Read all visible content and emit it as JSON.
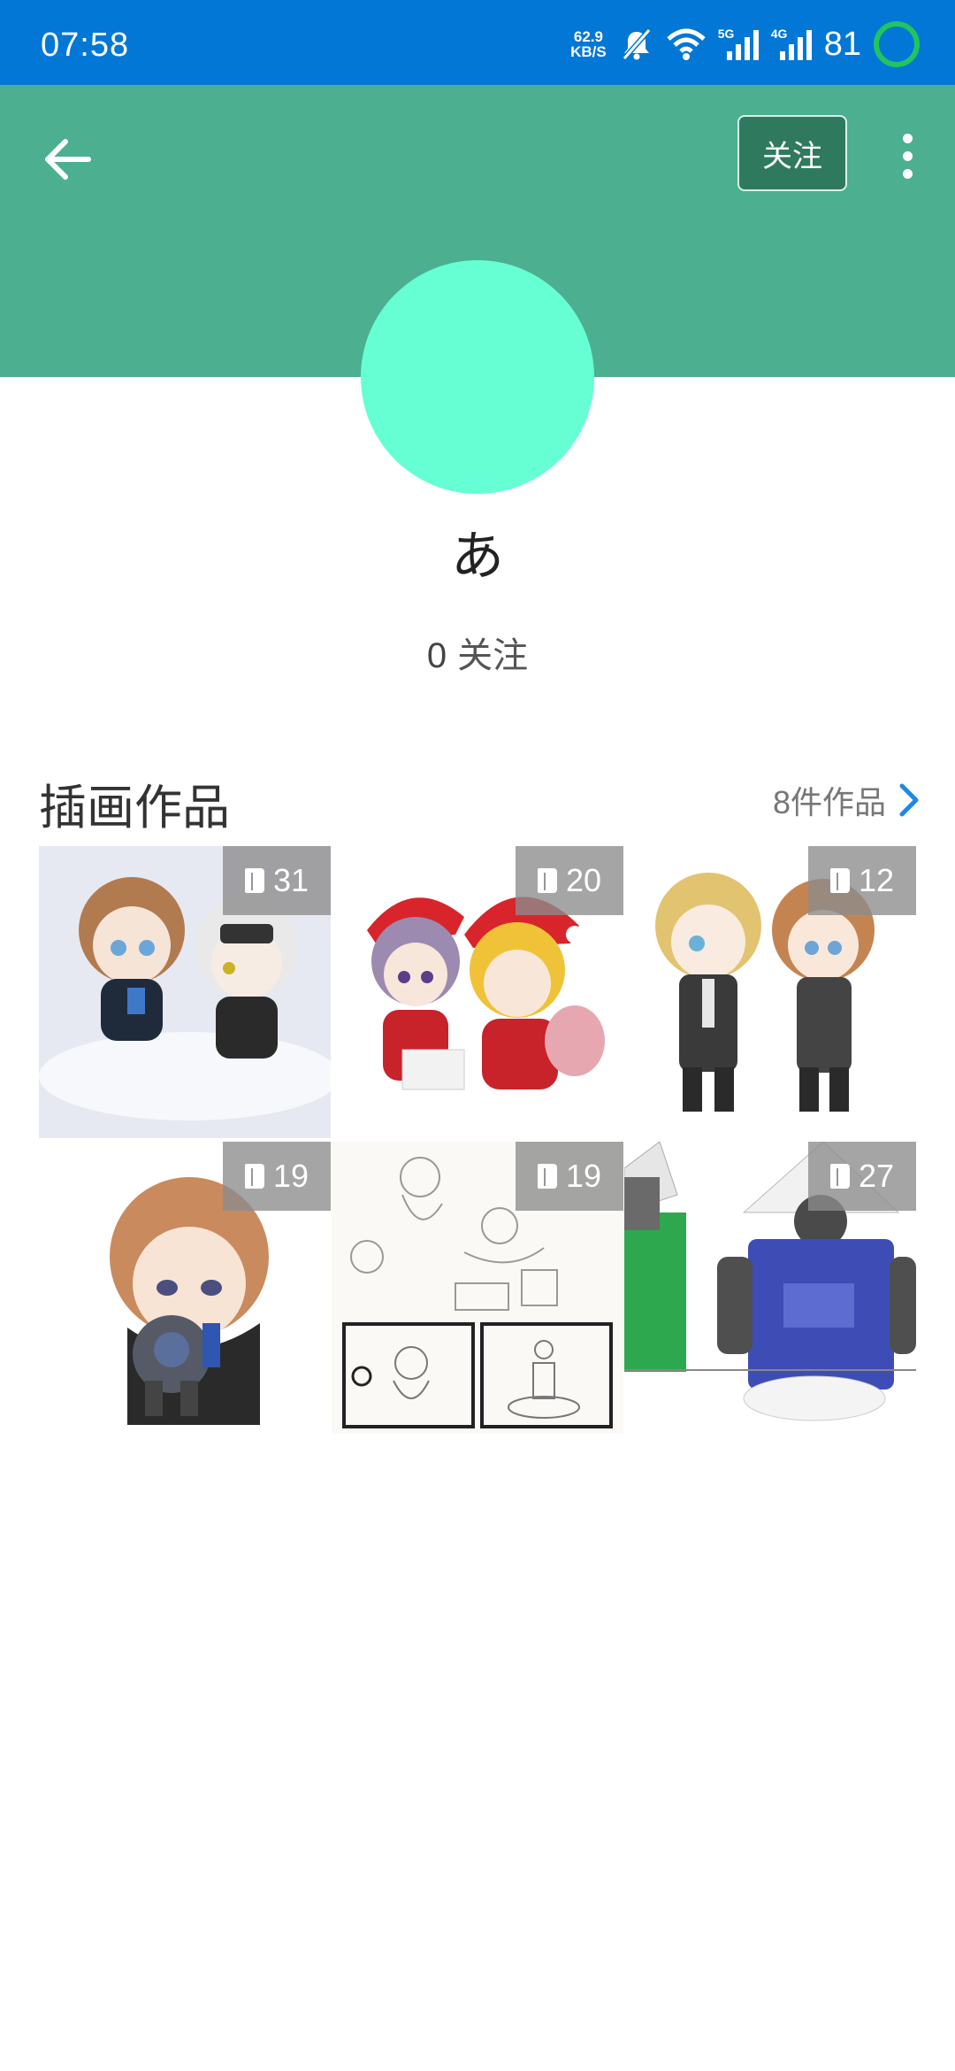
{
  "status_bar": {
    "time": "07:58",
    "speed_value": "62.9",
    "speed_unit": "KB/S",
    "sim1_tag": "5G",
    "sim2_tag": "4G",
    "battery": "81",
    "icons": [
      "mute-icon",
      "wifi-icon",
      "signal-5g-icon",
      "signal-4g-icon",
      "battery-ring-icon"
    ]
  },
  "header": {
    "back_icon": "arrow-left-icon",
    "follow_label": "关注",
    "more_icon": "more-vertical-icon",
    "colors": {
      "status_bar": "#0277d6",
      "band": "#4caf8f",
      "follow_button": "#2f7a5f",
      "avatar": "#66ffd4"
    }
  },
  "profile": {
    "name": "あ",
    "follow_count": "0",
    "follow_label": "关注"
  },
  "illustrations": {
    "title": "插画作品",
    "count_label": "8件作品",
    "more_icon": "chevron-right-icon",
    "items": [
      {
        "pages": "31"
      },
      {
        "pages": "20"
      },
      {
        "pages": "12"
      },
      {
        "pages": "19"
      },
      {
        "pages": "19"
      },
      {
        "pages": "27"
      }
    ]
  }
}
